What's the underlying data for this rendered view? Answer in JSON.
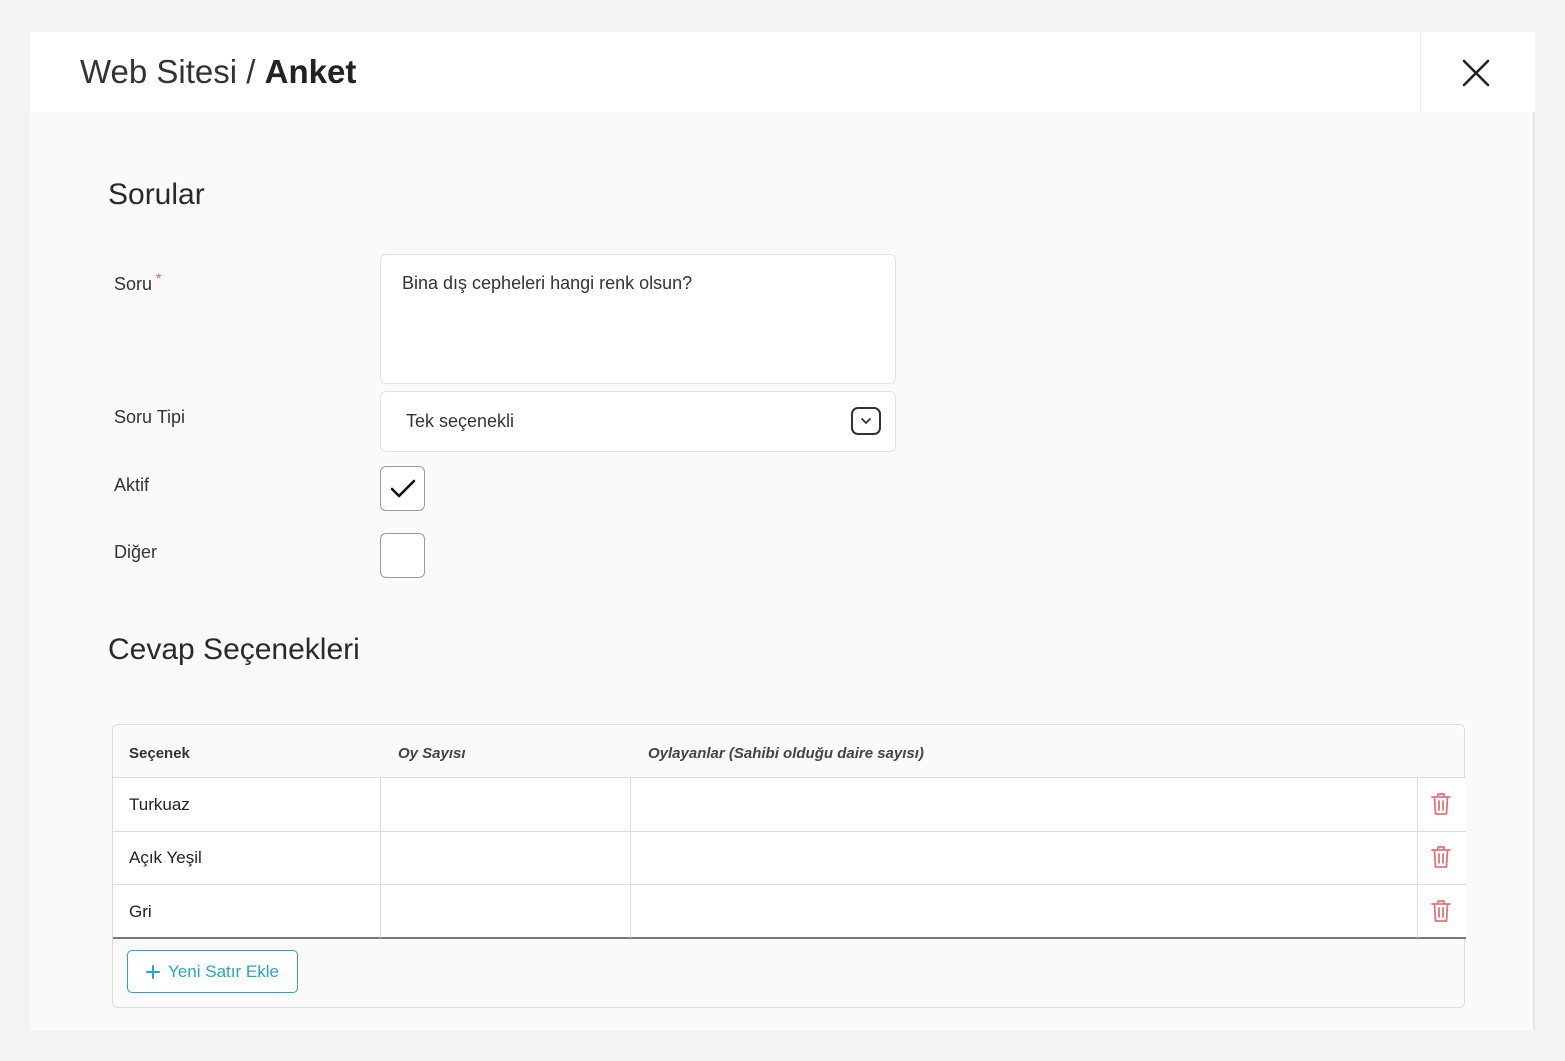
{
  "header": {
    "breadcrumb_parent": "Web Sitesi",
    "breadcrumb_separator": " / ",
    "breadcrumb_current": "Anket"
  },
  "questions_section": {
    "title": "Sorular",
    "question_label": "Soru",
    "required_mark": "*",
    "question_value": "Bina dış cepheleri hangi renk olsun?",
    "type_label": "Soru Tipi",
    "type_value": "Tek seçenekli",
    "active_label": "Aktif",
    "active_checked": true,
    "other_label": "Diğer",
    "other_checked": false
  },
  "answers_section": {
    "title": "Cevap Seçenekleri",
    "columns": [
      "Seçenek",
      "Oy Sayısı",
      "Oylayanlar (Sahibi olduğu daire sayısı)"
    ],
    "rows": [
      {
        "option": "Turkuaz",
        "votes": "",
        "voters": ""
      },
      {
        "option": "Açık Yeşil",
        "votes": "",
        "voters": ""
      },
      {
        "option": "Gri",
        "votes": "",
        "voters": ""
      }
    ],
    "add_row_label": "Yeni Satır Ekle"
  },
  "icons": {
    "close": "close-icon",
    "chevron": "chevron-down-icon",
    "check": "check-icon",
    "delete": "trash-icon",
    "add": "plus-icon"
  },
  "colors": {
    "accent": "#2aa3c9",
    "danger": "#e2737a",
    "required": "#e05a4e"
  }
}
